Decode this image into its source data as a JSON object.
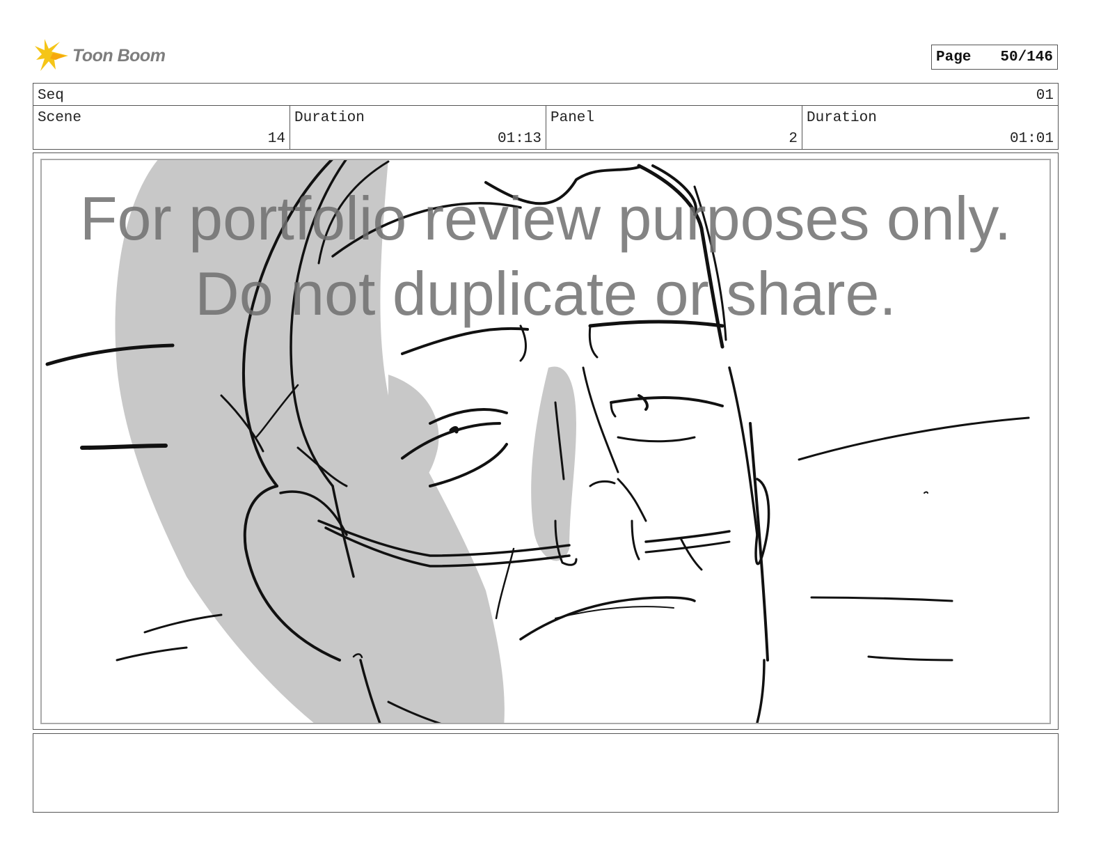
{
  "header": {
    "logo_text": "Toon Boom",
    "page_label": "Page",
    "page_value": "50/146"
  },
  "info": {
    "seq_label": "Seq",
    "seq_value": "01",
    "scene_label": "Scene",
    "scene_value": "14",
    "scene_duration_label": "Duration",
    "scene_duration_value": "01:13",
    "panel_label": "Panel",
    "panel_value": "2",
    "panel_duration_label": "Duration",
    "panel_duration_value": "01:01"
  },
  "watermark": {
    "line1": "For portfolio review purposes only.",
    "line2": "Do not duplicate or share."
  },
  "colors": {
    "logo_flame": "#f5c518",
    "border": "#555555",
    "sketch_shadow": "#c8c8c8",
    "watermark": "#6e6e6e"
  }
}
